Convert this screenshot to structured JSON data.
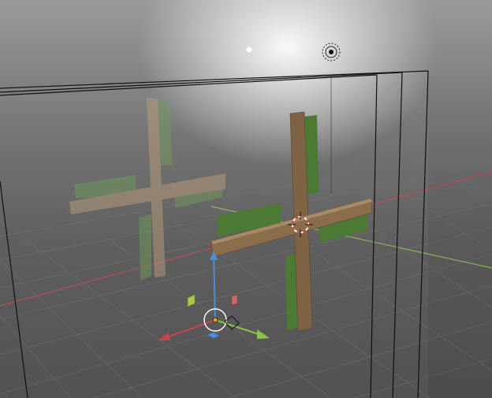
{
  "viewport": {
    "view": "3d-viewport-perspective",
    "colors": {
      "x_axis": "#c8454f",
      "y_axis": "#8bc34a",
      "z_axis": "#4a8fd8",
      "grid": "#6a6a6a",
      "wood": "#8a6e4b",
      "wood_light": "#a88b64",
      "foliage": "#4c7a34",
      "mirror_frame": "#111111",
      "cursor_ring": "#c8403a"
    },
    "objects": [
      {
        "name": "wooden-cross",
        "kind": "mesh"
      },
      {
        "name": "green-panels",
        "kind": "mesh"
      },
      {
        "name": "mirror-plane",
        "kind": "mesh"
      },
      {
        "name": "point-light",
        "kind": "light"
      },
      {
        "name": "sun-light",
        "kind": "light"
      }
    ],
    "gizmo": {
      "tool": "move",
      "axes": [
        "x",
        "y",
        "z"
      ],
      "plane_handles": [
        "xy",
        "xz",
        "yz"
      ]
    }
  }
}
